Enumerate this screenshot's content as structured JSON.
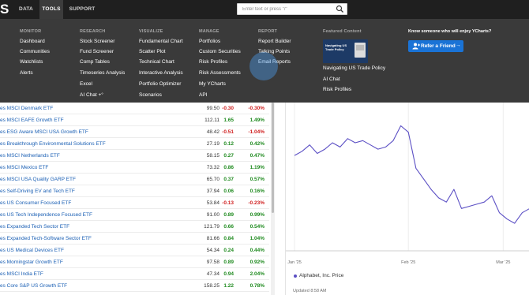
{
  "app": {
    "logo": "S"
  },
  "nav": {
    "tabs": [
      {
        "label": "DATA",
        "active": false
      },
      {
        "label": "TOOLS",
        "active": true
      },
      {
        "label": "SUPPORT",
        "active": false
      }
    ],
    "search_placeholder": "Enter text or press \"/\""
  },
  "menu": {
    "monitor": {
      "heading": "MONITOR",
      "items": [
        "Dashboard",
        "Communities",
        "Watchlists",
        "Alerts"
      ]
    },
    "research": {
      "heading": "RESEARCH",
      "items": [
        "Stock Screener",
        "Fund Screener",
        "Comp Tables",
        "Timeseries Analysis",
        "Excel",
        "AI Chat +°"
      ]
    },
    "visualize": {
      "heading": "VISUALIZE",
      "items": [
        "Fundamental Chart",
        "Scatter Plot",
        "Technical Chart",
        "Interactive Analysis",
        "Portfolio Optimizer",
        "Scenarios"
      ]
    },
    "manage": {
      "heading": "MANAGE",
      "items": [
        "Portfolios",
        "Custom Securities",
        "Risk Profiles",
        "Risk Assessments",
        "My YCharts",
        "API"
      ]
    },
    "report": {
      "heading": "REPORT",
      "items": [
        "Report Builder",
        "Talking Points",
        "Email Reports"
      ]
    },
    "featured": {
      "heading": "Featured Content",
      "thumb_text": "Navigating US Trade Policy",
      "items": [
        "Navigating US Trade Policy",
        "AI Chat",
        "Risk Profiles"
      ]
    },
    "friend": {
      "title": "Know someone who will enjoy YCharts?",
      "button_label": "Refer a Friend",
      "arrow": "→"
    }
  },
  "etf_table": {
    "rows": [
      {
        "name": "es MSCI Denmark ETF",
        "price": "99.50",
        "change": "-0.30",
        "pct": "-0.30%"
      },
      {
        "name": "es MSCI EAFE Growth ETF",
        "price": "112.11",
        "change": "1.65",
        "pct": "1.49%"
      },
      {
        "name": "es ESG Aware MSCI USA Growth ETF",
        "price": "48.42",
        "change": "-0.51",
        "pct": "-1.04%"
      },
      {
        "name": "es Breakthrough Environmental Solutions ETF",
        "price": "27.19",
        "change": "0.12",
        "pct": "0.42%"
      },
      {
        "name": "es MSCI Netherlands ETF",
        "price": "58.15",
        "change": "0.27",
        "pct": "0.47%"
      },
      {
        "name": "es MSCI Mexico ETF",
        "price": "73.32",
        "change": "0.86",
        "pct": "1.19%"
      },
      {
        "name": "es MSCI USA Quality GARP ETF",
        "price": "65.70",
        "change": "0.37",
        "pct": "0.57%"
      },
      {
        "name": "es Self-Driving EV and Tech ETF",
        "price": "37.94",
        "change": "0.06",
        "pct": "0.16%"
      },
      {
        "name": "es US Consumer Focused ETF",
        "price": "53.84",
        "change": "-0.13",
        "pct": "-0.23%"
      },
      {
        "name": "es US Tech Independence Focused ETF",
        "price": "91.00",
        "change": "0.89",
        "pct": "0.99%"
      },
      {
        "name": "es Expanded Tech Sector ETF",
        "price": "121.79",
        "change": "0.66",
        "pct": "0.54%"
      },
      {
        "name": "es Expanded Tech-Software Sector ETF",
        "price": "81.66",
        "change": "0.84",
        "pct": "1.04%"
      },
      {
        "name": "es US Medical Devices ETF",
        "price": "54.34",
        "change": "0.24",
        "pct": "0.44%"
      },
      {
        "name": "es Morningstar Growth ETF",
        "price": "97.58",
        "change": "0.89",
        "pct": "0.92%"
      },
      {
        "name": "es MSCI India ETF",
        "price": "47.34",
        "change": "0.94",
        "pct": "2.04%"
      },
      {
        "name": "es Core S&P US Growth ETF",
        "price": "158.25",
        "change": "1.22",
        "pct": "0.78%"
      }
    ]
  },
  "chart_data": {
    "type": "line",
    "title": "",
    "xlabel": "",
    "ylabel": "",
    "x_tick_labels": [
      "Jan '25",
      "Feb '25",
      "Mar '25"
    ],
    "x_tick_positions": [
      0,
      30,
      55
    ],
    "x": [
      0,
      2,
      4,
      6,
      8,
      10,
      12,
      14,
      16,
      18,
      20,
      22,
      24,
      26,
      28,
      30,
      32,
      34,
      36,
      38,
      40,
      42,
      44,
      46,
      48,
      50,
      52,
      54,
      56,
      58,
      60,
      62
    ],
    "series": [
      {
        "values": [
          200,
          202,
          205,
          201,
          203,
          206,
          204,
          208,
          206,
          207,
          205,
          203,
          204,
          207,
          214,
          211,
          194,
          189,
          184,
          180,
          178,
          184,
          175,
          176,
          177,
          178,
          181,
          173,
          170,
          168,
          173,
          175
        ]
      }
    ],
    "ylim": [
      155,
      225
    ],
    "grid": true,
    "legend": {
      "label": "Alphabet, Inc. Price",
      "color": "#5b4fc4",
      "placement": "bottom-left"
    },
    "updated": "Updated 8:58 AM"
  },
  "colors": {
    "nav_bg": "#1f1f1f",
    "menu_bg": "#3a3a3a",
    "link": "#1a5fb4",
    "positive": "#1e8a1e",
    "negative": "#d02020",
    "series": "#5b4fc4",
    "button": "#1a73d6"
  }
}
